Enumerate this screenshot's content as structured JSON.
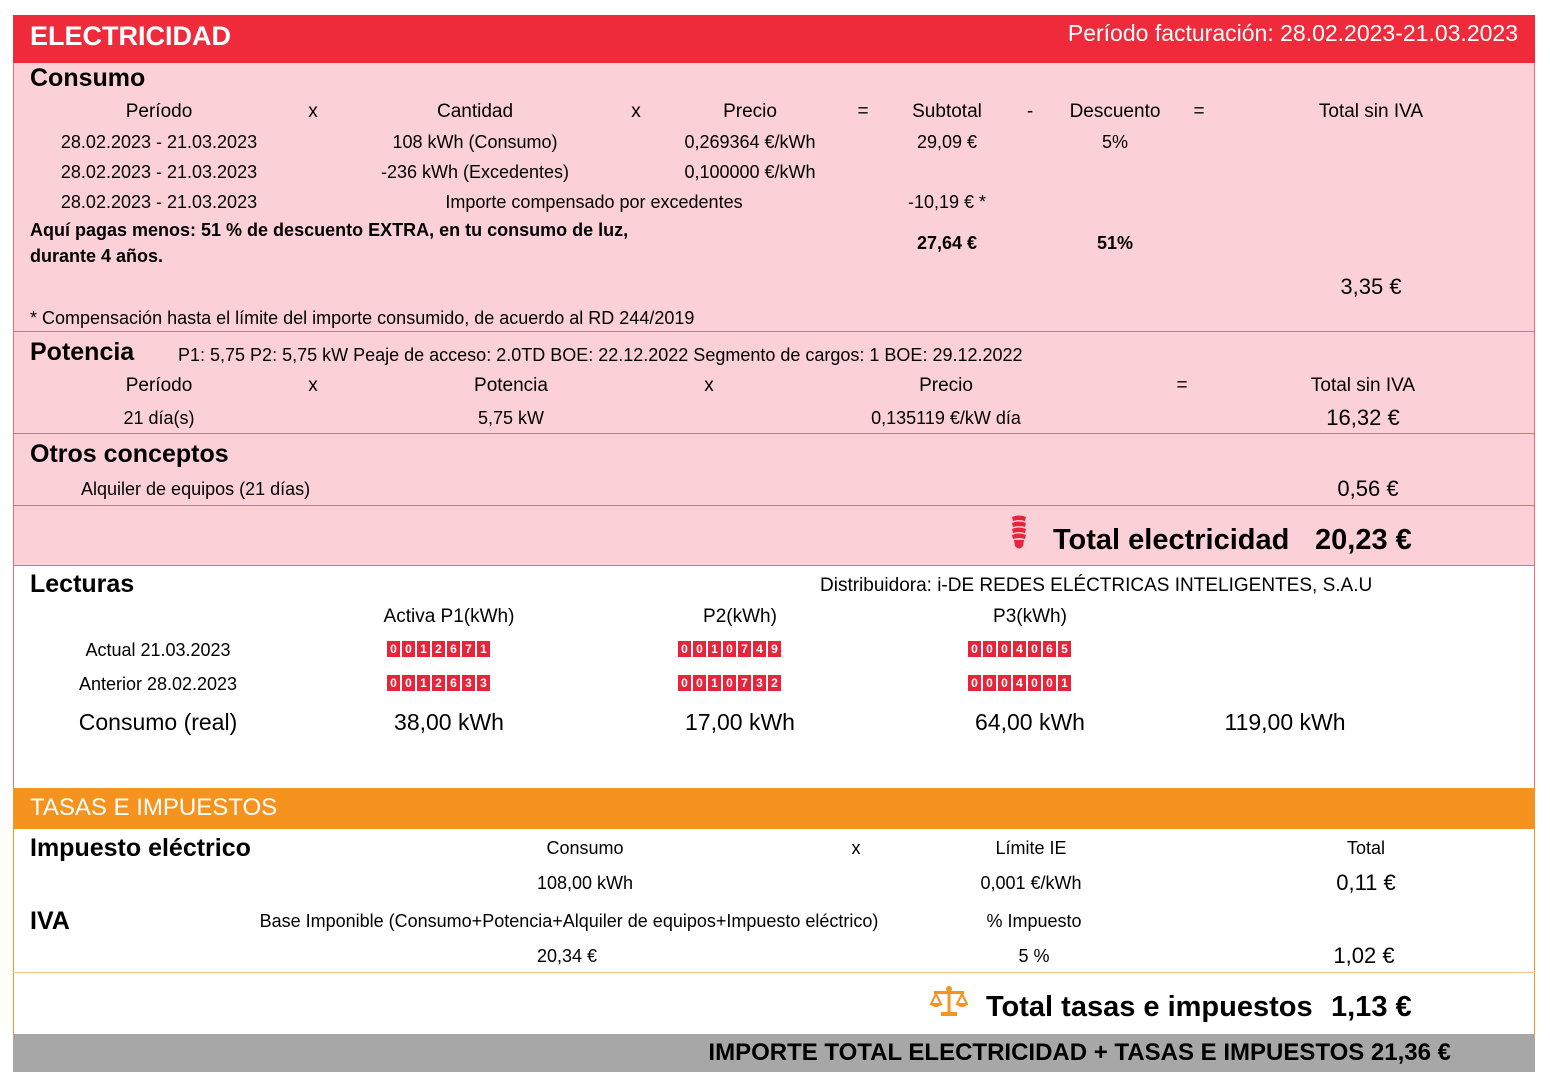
{
  "electricidad": {
    "title": "ELECTRICIDAD",
    "period": "Período facturación: 28.02.2023-21.03.2023",
    "color": "#ee2a3b"
  },
  "consumo": {
    "title": "Consumo",
    "headers": {
      "periodo": "Período",
      "x1": "x",
      "cantidad": "Cantidad",
      "x2": "x",
      "precio": "Precio",
      "eq1": "=",
      "subtotal": "Subtotal",
      "minus": "-",
      "descuento": "Descuento",
      "eq2": "=",
      "total": "Total sin IVA"
    },
    "rows": [
      {
        "periodo": "28.02.2023 - 21.03.2023",
        "cantidad": "108 kWh (Consumo)",
        "precio": "0,269364 €/kWh",
        "subtotal": "29,09 €",
        "descuento": "5%"
      },
      {
        "periodo": "28.02.2023 - 21.03.2023",
        "cantidad": "-236 kWh (Excedentes)",
        "precio": "0,100000 €/kWh"
      },
      {
        "periodo": "28.02.2023 - 21.03.2023",
        "importe": "Importe compensado por excedentes",
        "subtotal": "-10,19 € *"
      }
    ],
    "extra_line1": "Aquí pagas menos: 51 % de descuento EXTRA, en tu consumo de luz,",
    "extra_line2": "durante 4 años.",
    "extra_subtotal": "27,64 €",
    "extra_descuento": "51%",
    "total": "3,35 €",
    "note": "* Compensación hasta el límite del importe consumido, de acuerdo al RD 244/2019"
  },
  "potencia": {
    "title": "Potencia",
    "info": "P1: 5,75 P2: 5,75 kW  Peaje de acceso: 2.0TD  BOE: 22.12.2022  Segmento de cargos: 1  BOE: 29.12.2022",
    "headers": {
      "periodo": "Período",
      "x1": "x",
      "potencia": "Potencia",
      "x2": "x",
      "precio": "Precio",
      "eq": "=",
      "total": "Total sin IVA"
    },
    "row": {
      "periodo": "21 día(s)",
      "potencia": "5,75 kW",
      "precio": "0,135119 €/kW día",
      "total": "16,32 €"
    }
  },
  "otros": {
    "title": "Otros conceptos",
    "item": "Alquiler de equipos (21 días)",
    "total": "0,56 €"
  },
  "total_electricidad": {
    "label": "Total electricidad",
    "value": "20,23 €",
    "icon": "lightbulb-icon"
  },
  "lecturas": {
    "title": "Lecturas",
    "distribuidora": "Distribuidora: i-DE REDES ELÉCTRICAS INTELIGENTES, S.A.U",
    "col_p1": "Activa P1(kWh)",
    "col_p2": "P2(kWh)",
    "col_p3": "P3(kWh)",
    "actual_label": "Actual 21.03.2023",
    "anterior_label": "Anterior 28.02.2023",
    "actual": {
      "p1": "0012671",
      "p2": "0010749",
      "p3": "0004065"
    },
    "anterior": {
      "p1": "0012633",
      "p2": "0010732",
      "p3": "0004001"
    },
    "consumo_label": "Consumo (real)",
    "consumo": {
      "p1": "38,00 kWh",
      "p2": "17,00 kWh",
      "p3": "64,00 kWh",
      "total": "119,00 kWh"
    }
  },
  "tasas": {
    "title": "TASAS E IMPUESTOS",
    "color": "#f6931e",
    "ie_title": "Impuesto eléctrico",
    "ie_h_consumo": "Consumo",
    "ie_h_x": "x",
    "ie_h_limite": "Límite IE",
    "ie_h_total": "Total",
    "ie_consumo": "108,00 kWh",
    "ie_limite": "0,001 €/kWh",
    "ie_total": "0,11 €",
    "iva_title": "IVA",
    "iva_h_base": "Base Imponible (Consumo+Potencia+Alquiler de equipos+Impuesto eléctrico)",
    "iva_h_pct": "% Impuesto",
    "iva_base": "20,34 €",
    "iva_pct": "5 %",
    "iva_total": "1,02 €",
    "total_label": "Total tasas e impuestos",
    "total_value": "1,13 €",
    "icon": "scales-icon"
  },
  "importe_total": "IMPORTE TOTAL ELECTRICIDAD + TASAS E IMPUESTOS 21,36 €"
}
